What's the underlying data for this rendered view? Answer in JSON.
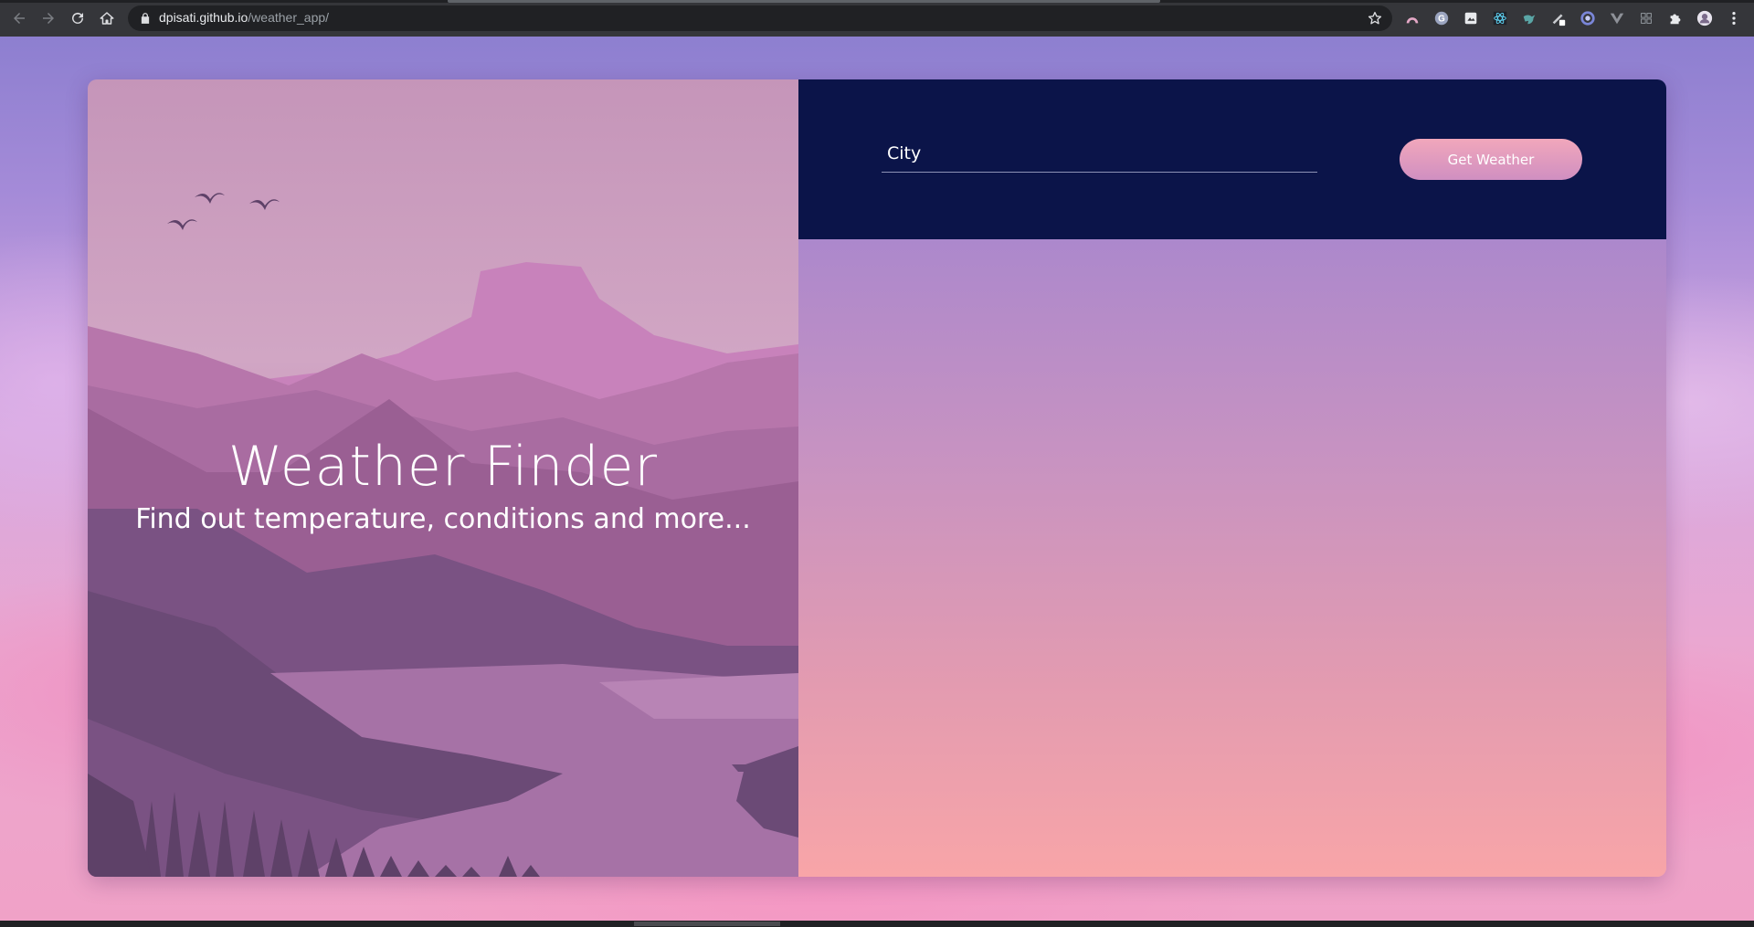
{
  "browser": {
    "url_host": "dpisati.github.io",
    "url_path": "/weather_app/",
    "nav": {
      "back_icon": "arrow-left-icon",
      "forward_icon": "arrow-right-icon",
      "reload_icon": "reload-icon",
      "home_icon": "home-icon"
    },
    "extensions": [
      "arc-extension-icon",
      "grammarly-extension-icon",
      "screenshot-extension-icon",
      "react-devtools-extension-icon",
      "bird-extension-icon",
      "pen-extension-icon",
      "circle-extension-icon",
      "vue-devtools-extension-icon",
      "grid-extension-icon",
      "puzzle-extensions-icon",
      "profile-avatar-icon",
      "menu-kebab-icon"
    ]
  },
  "hero": {
    "title": "Weather Finder",
    "subtitle": "Find out temperature, conditions and more..."
  },
  "form": {
    "city_placeholder": "City",
    "city_value": "",
    "submit_label": "Get Weather"
  },
  "colors": {
    "form_bar": "#0b1449",
    "button_top": "#f1a7bb",
    "button_bottom": "#d08fc1",
    "results_top": "#ac88cc",
    "results_bottom": "#f8a5a8"
  }
}
